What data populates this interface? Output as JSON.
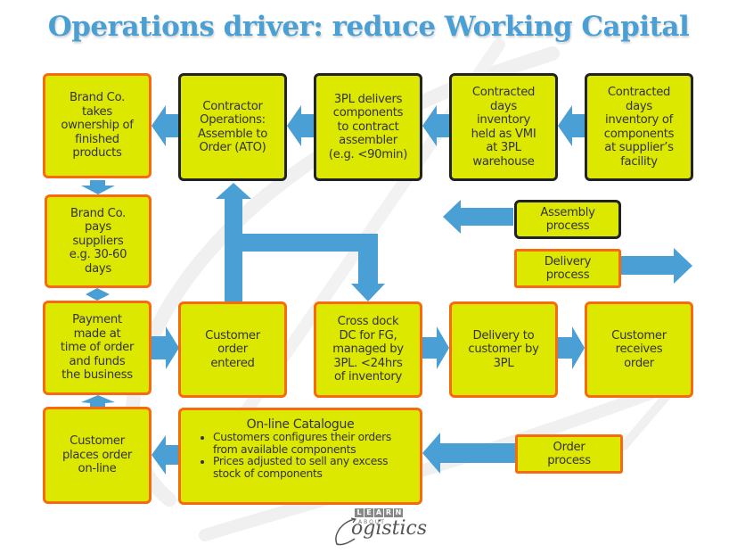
{
  "title": "Operations driver: reduce Working Capital",
  "colors": {
    "title": "#4a9fd5",
    "box_fill": "#dde800",
    "border_orange": "#f76a10",
    "border_black": "#222222",
    "arrow": "#4a9fd5",
    "text": "#333333"
  },
  "boxes": {
    "brand_takes_ownership": "Brand Co.\ntakes\nownership of\nfinished\nproducts",
    "contractor_ato": "Contractor\nOperations:\nAssemble to\nOrder (ATO)",
    "tpl_delivers_components": "3PL delivers\ncomponents\nto contract\nassembler\n(e.g. <90min)",
    "vmi_inventory": "Contracted\ndays\ninventory\nheld as VMI\nat 3PL\nwarehouse",
    "supplier_inventory": "Contracted\ndays\ninventory of\ncomponents\nat supplier’s\nfacility",
    "brand_pays_suppliers": "Brand Co.\npays\nsuppliers\ne.g. 30-60\ndays",
    "payment_made": "Payment\nmade at\ntime of order\nand funds\nthe business",
    "customer_order_entered": "Customer\norder\nentered",
    "cross_dock": "Cross dock\nDC for FG,\nmanaged by\n3PL. <24hrs\nof inventory",
    "delivery_to_customer": "Delivery to\ncustomer by\n3PL",
    "customer_receives": "Customer\nreceives\norder",
    "customer_places_order": "Customer\nplaces order\non-line"
  },
  "catalogue": {
    "title": "On-line Catalogue",
    "bullets": [
      "Customers configures their orders from available components",
      "Prices adjusted to sell any excess stock of components"
    ]
  },
  "legend": {
    "assembly": "Assembly\nprocess",
    "delivery": "Delivery\nprocess",
    "order": "Order\nprocess"
  },
  "logo": {
    "learn_letters": [
      "L",
      "E",
      "A",
      "R",
      "N"
    ],
    "about": "ABOUT",
    "name": "ogistics"
  }
}
